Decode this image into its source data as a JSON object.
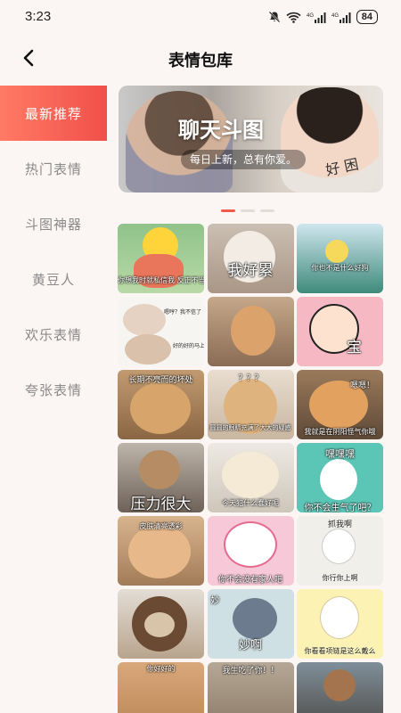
{
  "status": {
    "time": "3:23",
    "battery": "84"
  },
  "nav": {
    "title": "表情包库"
  },
  "sidebar": {
    "items": [
      {
        "label": "最新推荐",
        "active": true
      },
      {
        "label": "热门表情",
        "active": false
      },
      {
        "label": "斗图神器",
        "active": false
      },
      {
        "label": "黄豆人",
        "active": false
      },
      {
        "label": "欢乐表情",
        "active": false
      },
      {
        "label": "夸张表情",
        "active": false
      }
    ]
  },
  "banner": {
    "title": "聊天斗图",
    "subtitle": "每日上新，总有你爱。",
    "tag": "好 困"
  },
  "grid": {
    "c1": "你想我时就私信我 反正不当你对象",
    "c2": "我好累",
    "c3": "你也不是什么好狗",
    "c4a": "嗯哼？我不信了",
    "c4b": "好的好的马上干",
    "c6": "宝",
    "c7": "长期不亮而的坏处",
    "c8a": "？？？",
    "c8b": "圆圆的眼睛充满了大大的疑惑",
    "c9a": "嗯嗯！",
    "c9b": "我就是在阴阳怪气你哦",
    "c10": "压力很大",
    "c11": "今天犯什么蠢好呢",
    "c12a": "嘿嘿嘿",
    "c12b": "你不会生气了吧？",
    "c13": "皮肤清亮透彩",
    "c14": "你不会没有家人吧",
    "c15a": "抓我啊",
    "c15b": "你行你上啊",
    "c17": "妙啊",
    "c17b": "妙",
    "c18": "你看看项链是这么戴么",
    "c19": "你好好的",
    "c20": "我生吃了你！！"
  }
}
